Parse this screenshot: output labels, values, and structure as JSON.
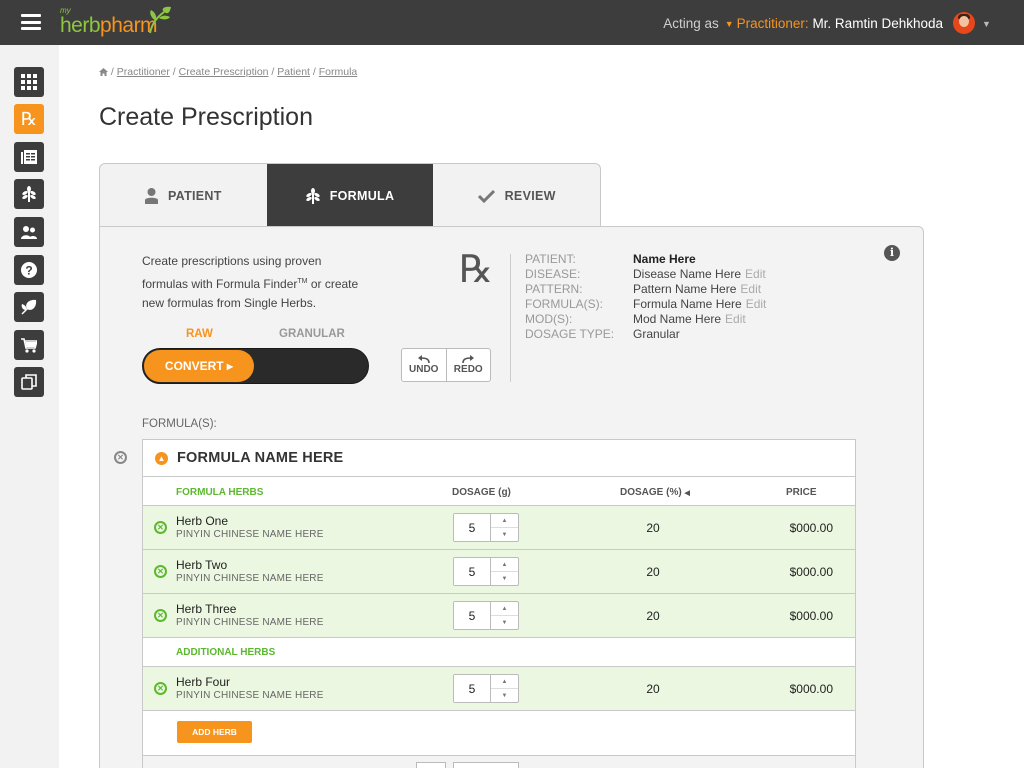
{
  "header": {
    "logo_my": "my",
    "logo_herb": "herb",
    "logo_pharm": "pharm",
    "acting_as": "Acting as",
    "role": "Practitioner:",
    "user_name": "Mr. Ramtin Dehkhoda"
  },
  "sidebar": {
    "items": [
      {
        "icon": "grid-icon"
      },
      {
        "icon": "rx-icon",
        "label": "Rx",
        "active": true
      },
      {
        "icon": "catalog-icon"
      },
      {
        "icon": "herb-icon"
      },
      {
        "icon": "patients-icon"
      },
      {
        "icon": "help-icon"
      },
      {
        "icon": "leaf-icon"
      },
      {
        "icon": "cart-icon"
      },
      {
        "icon": "copy-icon"
      }
    ]
  },
  "breadcrumb": {
    "items": [
      "Practitioner",
      "Create Prescription",
      "Patient",
      "Formula"
    ]
  },
  "page_title": "Create Prescription",
  "tabs": [
    {
      "label": "PATIENT",
      "icon": "person-icon",
      "active": false
    },
    {
      "label": "FORMULA",
      "icon": "herb-icon",
      "active": true
    },
    {
      "label": "REVIEW",
      "icon": "check-icon",
      "active": false
    }
  ],
  "intro": {
    "line1": "Create prescriptions using proven",
    "line2": "formulas with Formula Finder",
    "tm": "TM",
    "line2b": " or create",
    "line3": "new formulas from Single Herbs."
  },
  "mode_toggle": {
    "raw": "RAW",
    "granular": "GRANULAR",
    "convert": "CONVERT"
  },
  "rx_symbol": "℞",
  "actions": {
    "undo": "UNDO",
    "redo": "REDO"
  },
  "summary": {
    "patient_label": "PATIENT:",
    "patient_value": "Name Here",
    "disease_label": "DISEASE:",
    "disease_value": "Disease Name Here",
    "pattern_label": "PATTERN:",
    "pattern_value": "Pattern Name Here",
    "formula_label": "FORMULA(S):",
    "formula_value": "Formula Name Here",
    "mods_label": "MOD(S):",
    "mods_value": "Mod Name Here",
    "dosage_type_label": "DOSAGE TYPE:",
    "dosage_type_value": "Granular",
    "edit": "Edit"
  },
  "formulas_label": "FORMULA(S):",
  "formula": {
    "name": "FORMULA NAME HERE",
    "columns": {
      "herbs": "FORMULA HERBS",
      "dosage_g": "DOSAGE (g)",
      "dosage_pct": "DOSAGE (%)",
      "price": "PRICE"
    },
    "herbs": [
      {
        "name": "Herb One",
        "pinyin": "PINYIN CHINESE NAME HERE",
        "dosage": "5",
        "pct": "20",
        "price": "$000.00"
      },
      {
        "name": "Herb Two",
        "pinyin": "PINYIN CHINESE NAME HERE",
        "dosage": "5",
        "pct": "20",
        "price": "$000.00"
      },
      {
        "name": "Herb Three",
        "pinyin": "PINYIN CHINESE NAME HERE",
        "dosage": "5",
        "pct": "20",
        "price": "$000.00"
      }
    ],
    "additional_label": "ADDITIONAL HERBS",
    "additional": [
      {
        "name": "Herb Four",
        "pinyin": "PINYIN CHINESE NAME HERE",
        "dosage": "5",
        "pct": "20",
        "price": "$000.00"
      }
    ],
    "add_herb": "ADD HERB"
  },
  "colors": {
    "accent": "#f7941d",
    "brand_green": "#8dc63f",
    "dark": "#3d3d3d",
    "row_green": "#ecf7e1"
  }
}
